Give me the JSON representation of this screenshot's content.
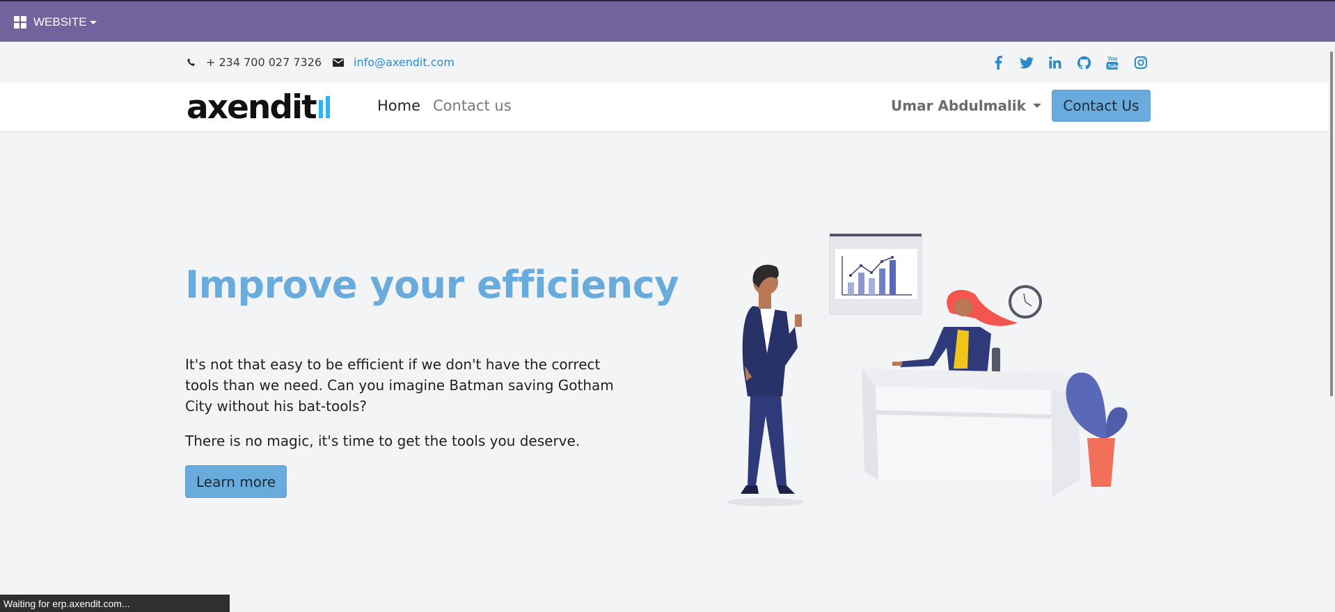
{
  "adminbar": {
    "app_label": "WEBSITE",
    "icon": "apps-grid-icon",
    "bg_color": "#71639e"
  },
  "topbar": {
    "phone": "+ 234 700 027 7326",
    "email": "info@axendit.com",
    "social": [
      "facebook-icon",
      "twitter-icon",
      "linkedin-icon",
      "github-icon",
      "youtube-icon",
      "instagram-icon"
    ],
    "accent_color": "#2b8ac9"
  },
  "navbar": {
    "logo_text": "axendit",
    "links": [
      "Home",
      "Contact us"
    ],
    "user_name": "Umar Abdulmalik",
    "cta_label": "Contact Us",
    "cta_color": "#6aabdd"
  },
  "hero": {
    "title": "Improve your efficiency",
    "paragraph1": "It's not that easy to be efficient if we don't have the correct tools than we need. Can you imagine Batman saving Gotham City without his bat-tools?",
    "paragraph2": "There is no magic, it's time to get the tools you deserve.",
    "button_label": "Learn more",
    "title_color": "#69abdc"
  },
  "statusbar": {
    "text": "Waiting for erp.axendit.com..."
  }
}
